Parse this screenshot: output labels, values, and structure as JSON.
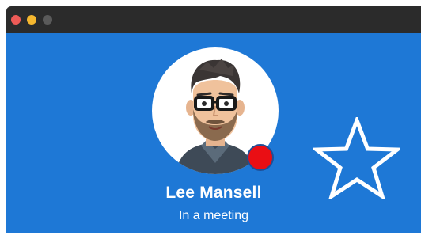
{
  "window": {
    "controls": {
      "close_color": "#ee5b57",
      "minimize_color": "#f5b72f",
      "zoom_color": "#5a5a5a"
    },
    "background_color": "#1e78d6"
  },
  "contact": {
    "name": "Lee Mansell",
    "status": "In a meeting",
    "presence_color": "#ea0e14",
    "avatar_icon": "cartoon-person-avatar"
  },
  "favorite": {
    "icon": "star-outline-icon",
    "color": "#ffffff"
  }
}
